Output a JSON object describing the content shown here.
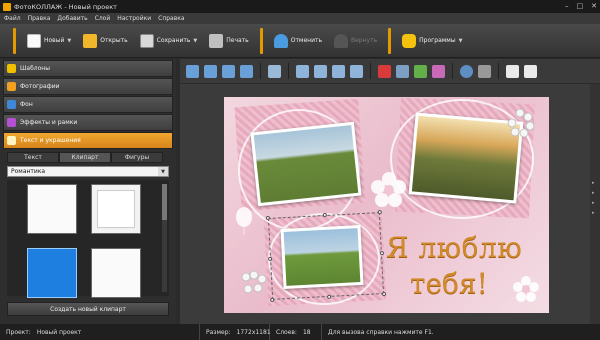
{
  "window": {
    "title": "ФотоКОЛЛАЖ - Новый проект"
  },
  "menu": [
    "Файл",
    "Правка",
    "Добавить",
    "Слой",
    "Настройки",
    "Справка"
  ],
  "toolbar": {
    "new_label": "Новый",
    "open_label": "Открыть",
    "save_label": "Сохранить",
    "print_label": "Печать",
    "undo_label": "Отменить",
    "redo_label": "Вернуть",
    "programs_label": "Программы"
  },
  "sidebar": {
    "items": [
      {
        "label": "Шаблоны",
        "icon": "star-icon",
        "color": "#f0c000"
      },
      {
        "label": "Фотографии",
        "icon": "photos-icon",
        "color": "#f3a020"
      },
      {
        "label": "Фон",
        "icon": "background-icon",
        "color": "#3d88d8"
      },
      {
        "label": "Эффекты и рамки",
        "icon": "effects-icon",
        "color": "#b54fd4"
      },
      {
        "label": "Текст и украшения",
        "icon": "text-icon",
        "color": "#f0a000"
      }
    ],
    "tabs": [
      "Текст",
      "Клипарт",
      "Фигуры"
    ],
    "category": "Романтика",
    "create_button": "Создать новый клипарт"
  },
  "canvas": {
    "text_line1": "Я люблю",
    "text_line2": "тебя!"
  },
  "status": {
    "project_label": "Проект:",
    "project_value": "Новый проект",
    "size_label": "Размер:",
    "size_value": "1772x1181",
    "layers_label": "Слоев:",
    "layers_value": "18",
    "help_text": "Для вызова справки нажмите F1."
  },
  "colors": {
    "accent": "#e39a00",
    "selected_clipart": "#1f7fe0"
  }
}
